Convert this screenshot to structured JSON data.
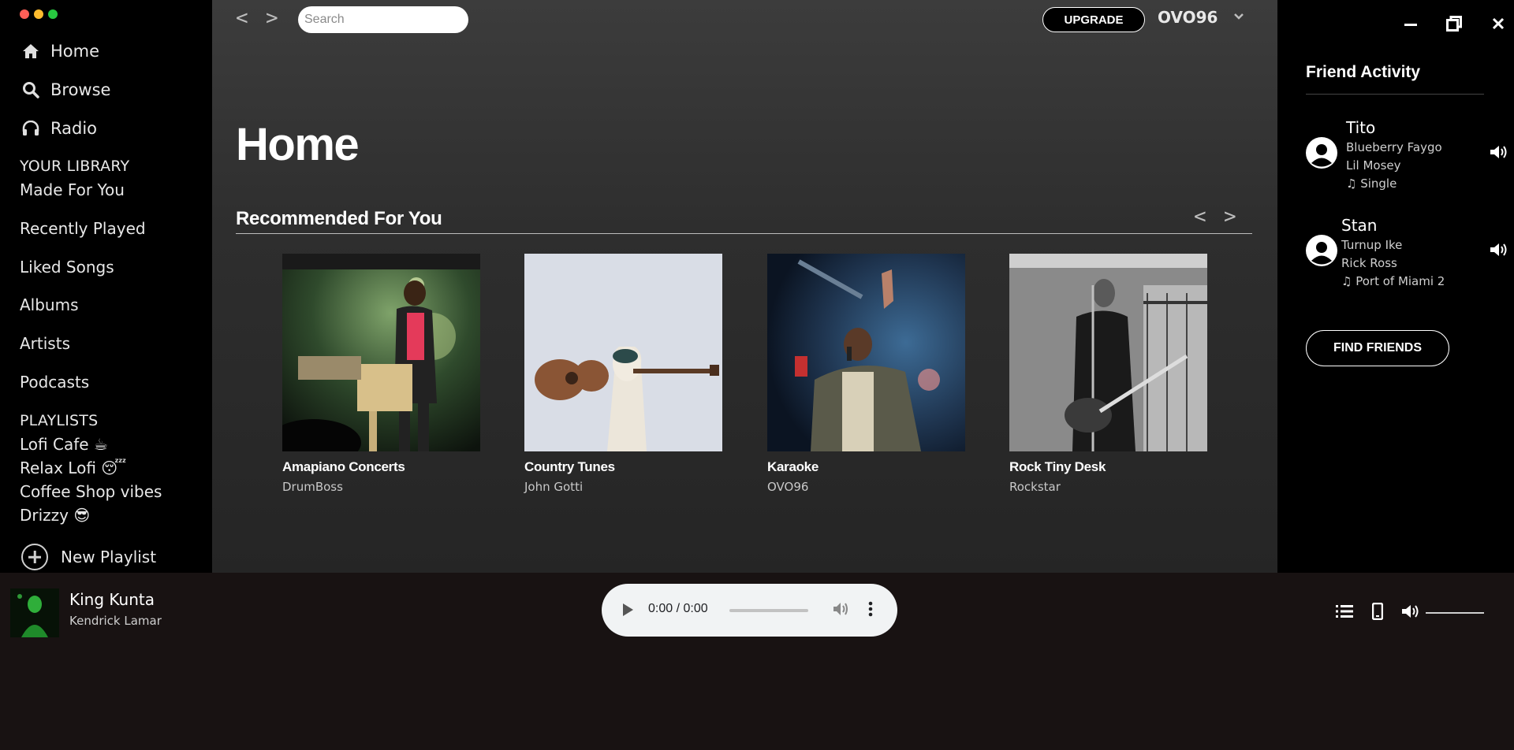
{
  "window": {
    "traffic_lights": {
      "close": "#ff5f57",
      "minimize": "#febc2e",
      "maximize": "#28c840"
    },
    "controls": [
      "minimize-icon",
      "restore-icon",
      "close-icon"
    ]
  },
  "sidebar": {
    "nav": [
      {
        "label": "Home",
        "icon": "home-icon"
      },
      {
        "label": "Browse",
        "icon": "search-icon"
      },
      {
        "label": "Radio",
        "icon": "headphones-icon"
      }
    ],
    "library_heading": "YOUR LIBRARY",
    "library": [
      "Made For You",
      "Recently Played",
      "Liked Songs",
      "Albums",
      "Artists",
      "Podcasts"
    ],
    "playlists_heading": "PLAYLISTS",
    "playlists": [
      "Lofi Cafe ☕",
      "Relax Lofi 😴",
      "Coffee Shop vibes",
      "Drizzy 😎"
    ],
    "new_playlist": "New Playlist"
  },
  "topbar": {
    "back": "<",
    "forward": ">",
    "search_placeholder": "Search",
    "upgrade": "UPGRADE",
    "username": "OVO96"
  },
  "main": {
    "title": "Home",
    "section_title": "Recommended For You",
    "carousel_prev": "<",
    "carousel_next": ">",
    "cards": [
      {
        "title": "Amapiano Concerts",
        "subtitle": "DrumBoss"
      },
      {
        "title": "Country Tunes",
        "subtitle": "John Gotti"
      },
      {
        "title": "Karaoke",
        "subtitle": "OVO96"
      },
      {
        "title": "Rock Tiny Desk",
        "subtitle": "Rockstar"
      }
    ]
  },
  "friend_activity": {
    "title": "Friend Activity",
    "friends": [
      {
        "name": "Tito",
        "song": "Blueberry Faygo",
        "artist": "Lil Mosey",
        "album": "Single"
      },
      {
        "name": "Stan",
        "song": "Turnup Ike",
        "artist": "Rick Ross",
        "album": "Port of Miami 2"
      }
    ],
    "find_friends": "FIND FRIENDS"
  },
  "player": {
    "track": "King Kunta",
    "artist": "Kendrick Lamar",
    "time": "0:00 / 0:00",
    "progress": 0,
    "volume": 1.0
  }
}
